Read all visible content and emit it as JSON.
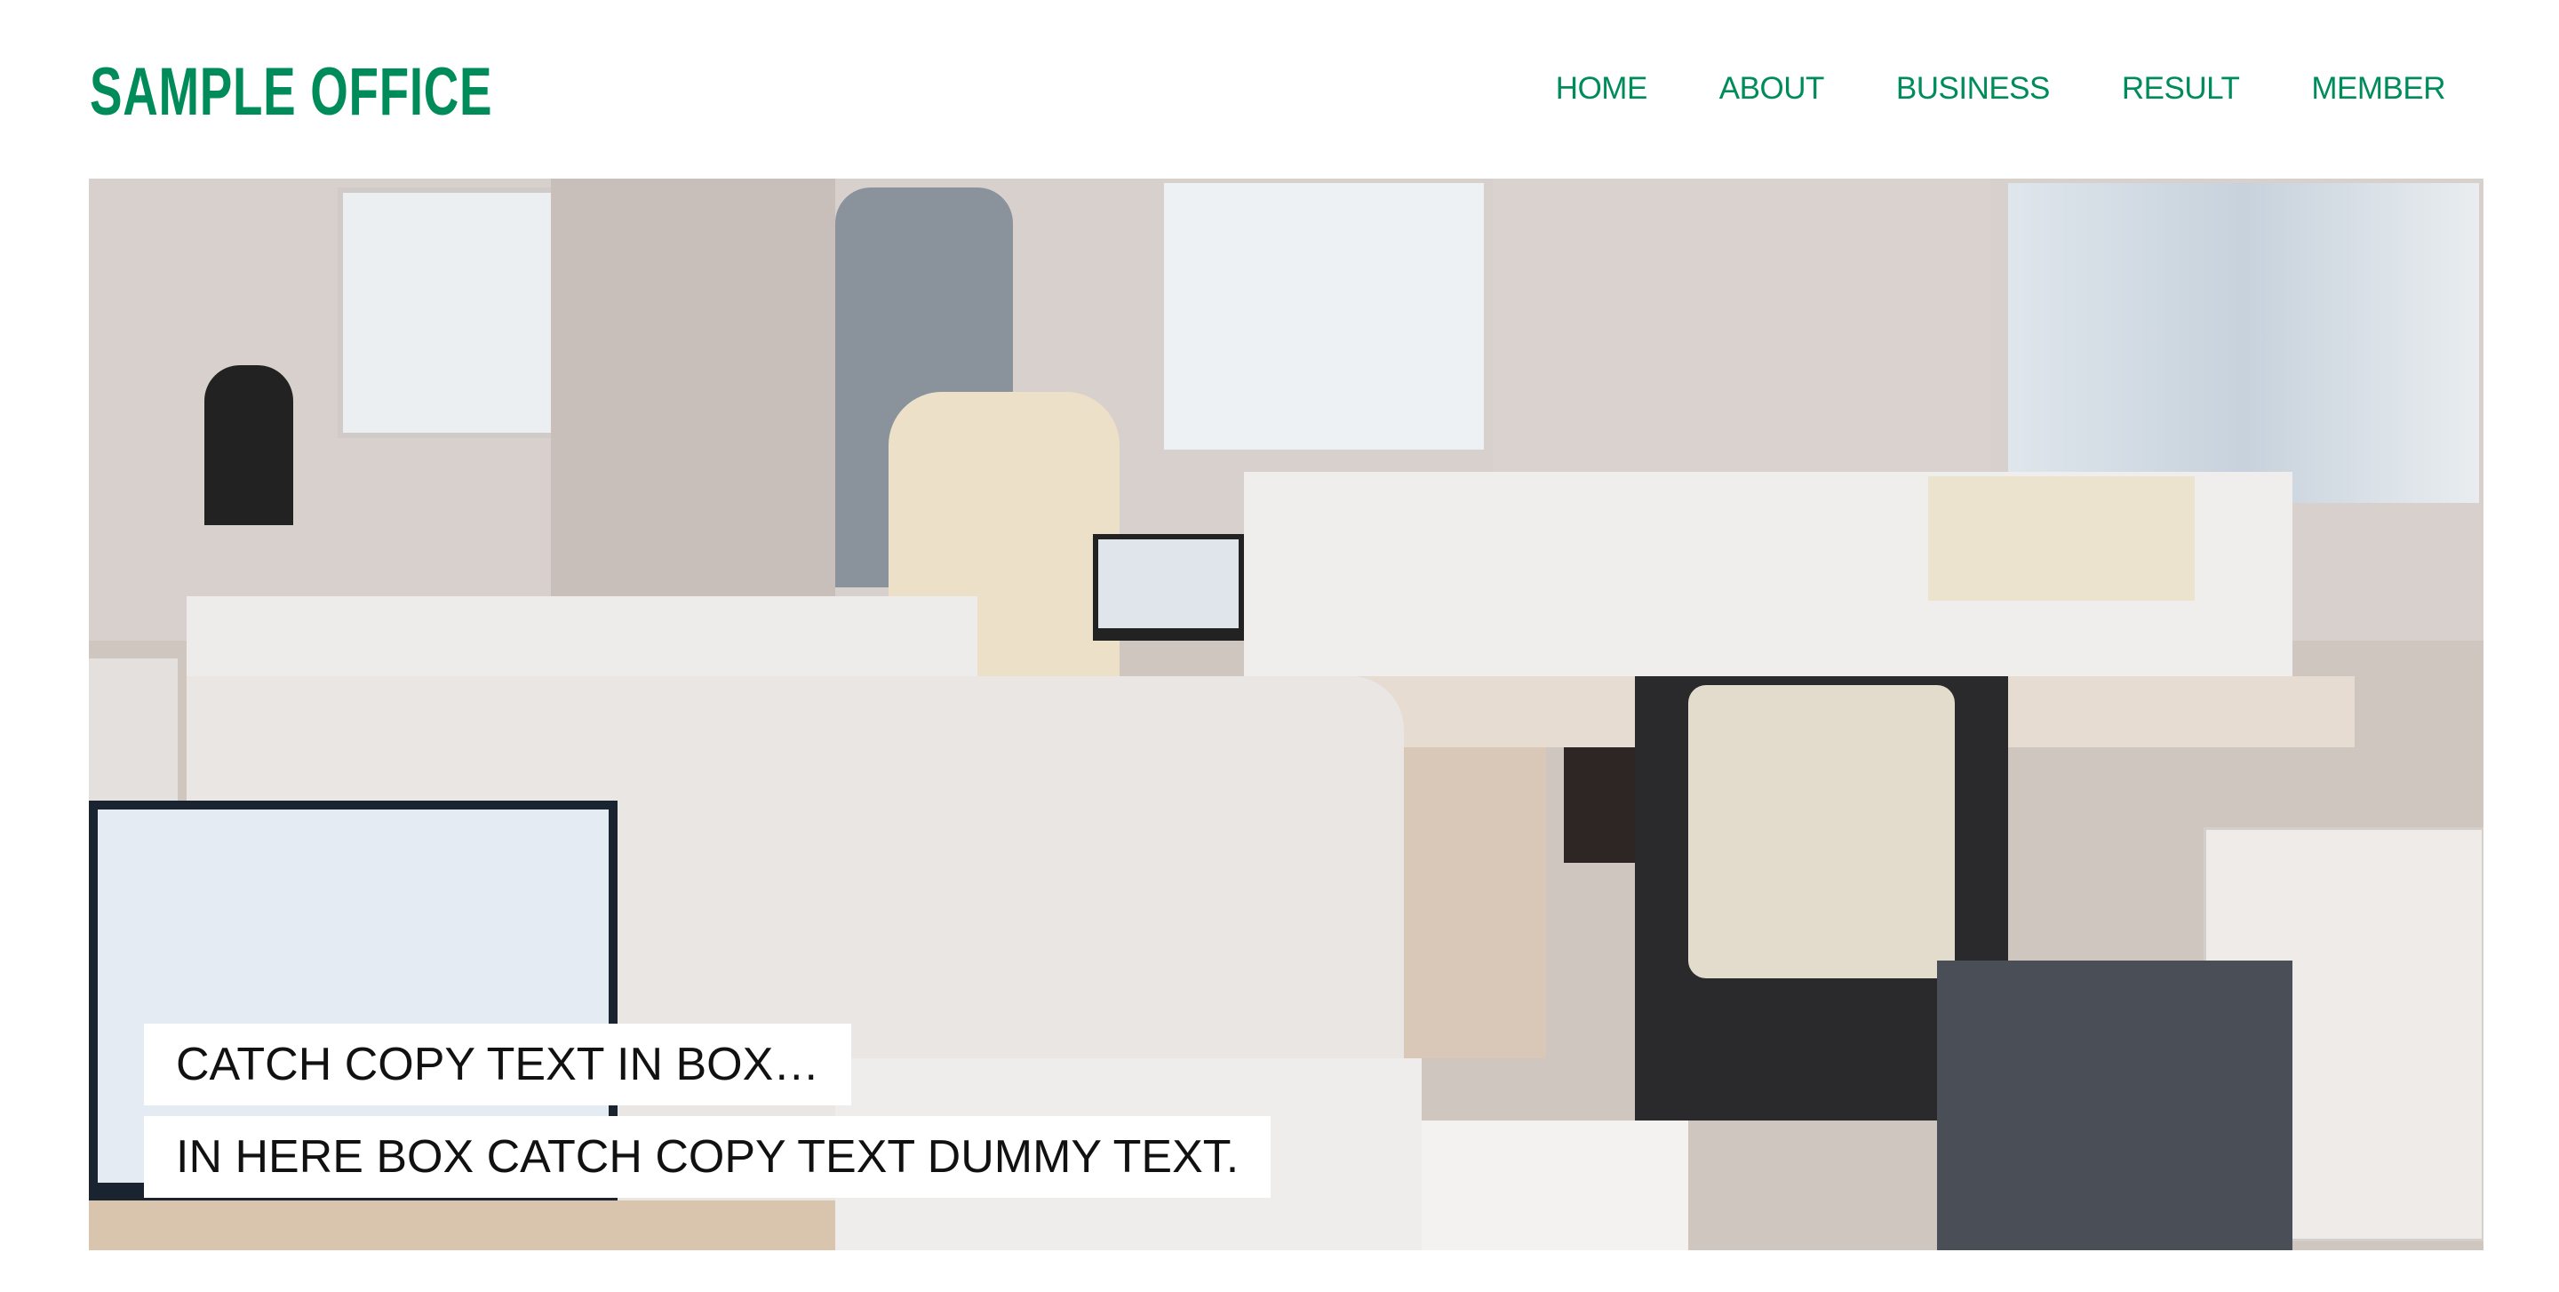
{
  "header": {
    "logo": "SAMPLE OFFICE",
    "nav": [
      "HOME",
      "ABOUT",
      "BUSINESS",
      "RESULT",
      "MEMBER"
    ]
  },
  "hero": {
    "image_alt": "office-photo",
    "catch_copy": [
      "CATCH COPY TEXT IN BOX…",
      "IN HERE BOX CATCH COPY TEXT DUMMY TEXT."
    ]
  },
  "colors": {
    "brand": "#008c5a"
  }
}
